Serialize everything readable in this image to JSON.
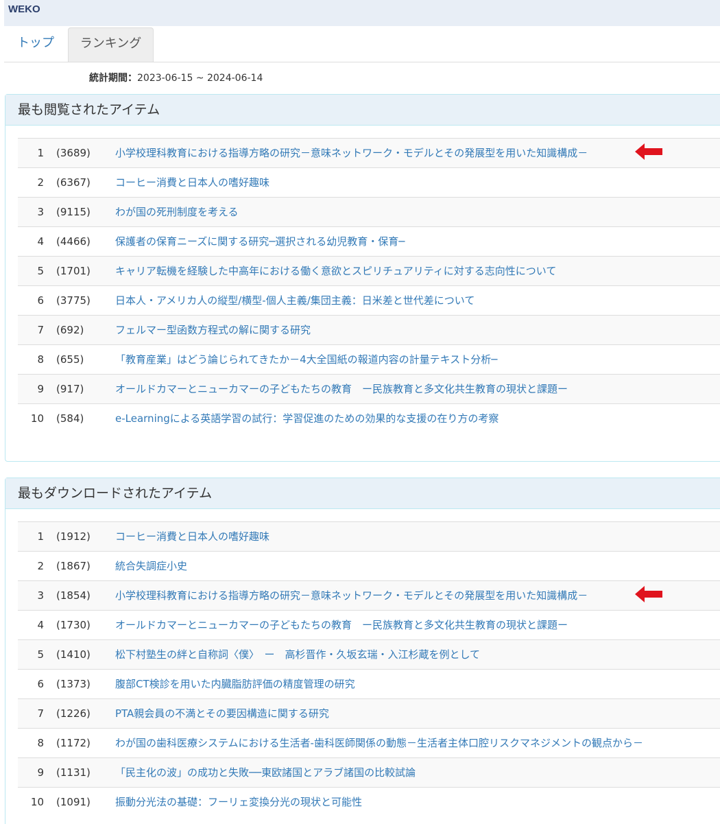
{
  "header": {
    "brand": "WEKO"
  },
  "tabs": [
    {
      "label": "トップ"
    },
    {
      "label": "ランキング"
    }
  ],
  "period": {
    "label": "統計期間：",
    "value": "2023-06-15 ~ 2024-06-14"
  },
  "most_viewed": {
    "heading": "最も閲覧されたアイテム",
    "items": [
      {
        "rank": "1",
        "count": "(3689)",
        "title": "小学校理科教育における指導方略の研究－意味ネットワーク・モデルとその発展型を用いた知識構成－"
      },
      {
        "rank": "2",
        "count": "(6367)",
        "title": "コーヒー消費と日本人の嗜好趣味"
      },
      {
        "rank": "3",
        "count": "(9115)",
        "title": "わが国の死刑制度を考える"
      },
      {
        "rank": "4",
        "count": "(4466)",
        "title": "保護者の保育ニーズに関する研究─選択される幼児教育・保育─"
      },
      {
        "rank": "5",
        "count": "(1701)",
        "title": "キャリア転機を経験した中高年における働く意欲とスピリチュアリティに対する志向性について"
      },
      {
        "rank": "6",
        "count": "(3775)",
        "title": "日本人・アメリカ人の縦型/横型-個人主義/集団主義：日米差と世代差について"
      },
      {
        "rank": "7",
        "count": "(692)",
        "title": "フェルマー型函数方程式の解に関する研究"
      },
      {
        "rank": "8",
        "count": "(655)",
        "title": "「教育産業」はどう論じられてきたか－4大全国紙の報道内容の計量テキスト分析─"
      },
      {
        "rank": "9",
        "count": "(917)",
        "title": "オールドカマーとニューカマーの子どもたちの教育　ー民族教育と多文化共生教育の現状と課題ー"
      },
      {
        "rank": "10",
        "count": "(584)",
        "title": "e-Learningによる英語学習の試行：学習促進のための効果的な支援の在り方の考察"
      }
    ]
  },
  "most_downloaded": {
    "heading": "最もダウンロードされたアイテム",
    "items": [
      {
        "rank": "1",
        "count": "(1912)",
        "title": "コーヒー消費と日本人の嗜好趣味"
      },
      {
        "rank": "2",
        "count": "(1867)",
        "title": "統合失調症小史"
      },
      {
        "rank": "3",
        "count": "(1854)",
        "title": "小学校理科教育における指導方略の研究－意味ネットワーク・モデルとその発展型を用いた知識構成－"
      },
      {
        "rank": "4",
        "count": "(1730)",
        "title": "オールドカマーとニューカマーの子どもたちの教育　ー民族教育と多文化共生教育の現状と課題ー"
      },
      {
        "rank": "5",
        "count": "(1410)",
        "title": "松下村塾生の絆と自称詞〈僕〉　ー　高杉晋作・久坂玄瑞・入江杉蔵を例として"
      },
      {
        "rank": "6",
        "count": "(1373)",
        "title": "腹部CT検診を用いた内臓脂肪評価の精度管理の研究"
      },
      {
        "rank": "7",
        "count": "(1226)",
        "title": "PTA親会員の不満とその要因構造に関する研究"
      },
      {
        "rank": "8",
        "count": "(1172)",
        "title": "わが国の歯科医療システムにおける生活者-歯科医師関係の動態－生活者主体口腔リスクマネジメントの観点から－"
      },
      {
        "rank": "9",
        "count": "(1131)",
        "title": "「民主化の波」の成功と失敗──東欧諸国とアラブ諸国の比較試論"
      },
      {
        "rank": "10",
        "count": "(1091)",
        "title": "振動分光法の基礎：フーリェ変換分光の現状と可能性"
      }
    ]
  },
  "annotation": {
    "arrow_color": "#e0141e"
  }
}
